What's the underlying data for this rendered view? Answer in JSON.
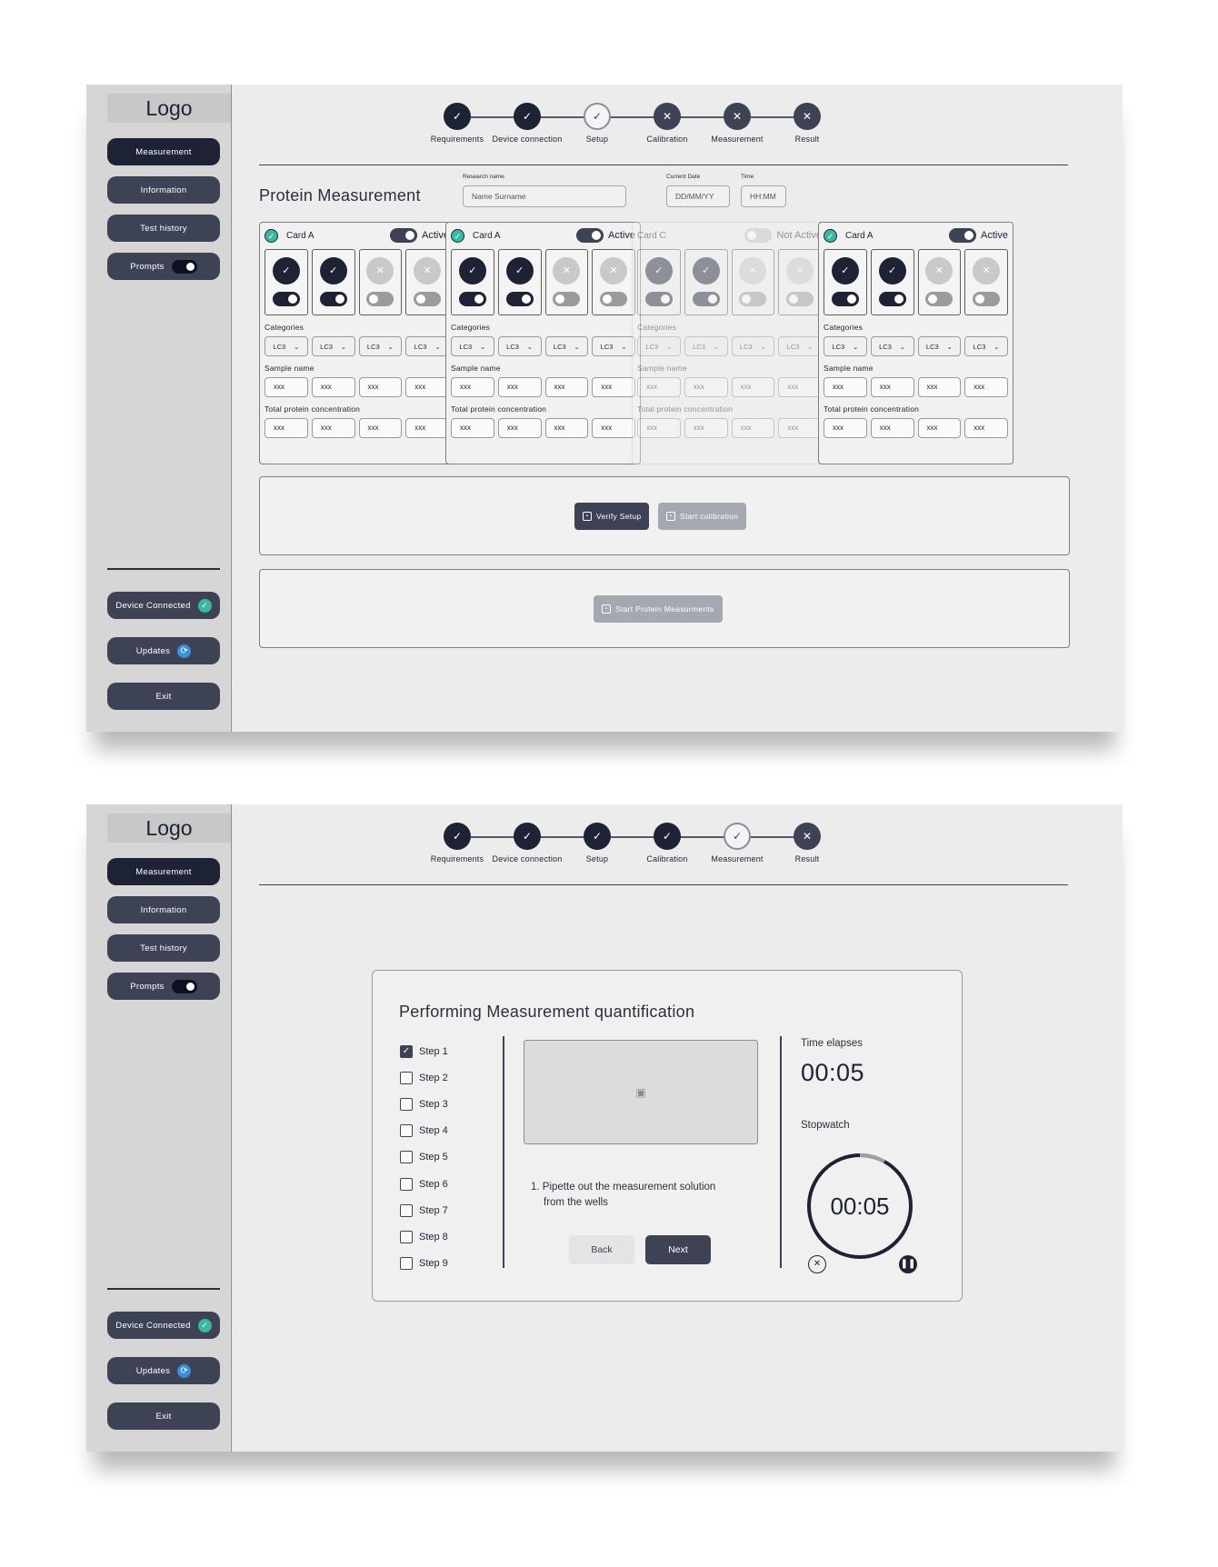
{
  "screen1": {
    "sidebar": {
      "logo": "Logo",
      "nav": [
        "Measurement",
        "Information",
        "Test history",
        "Prompts"
      ],
      "bottom": [
        "Device Connected",
        "Updates",
        "Exit"
      ]
    },
    "stepper": [
      {
        "label": "Requirements",
        "state": "done"
      },
      {
        "label": "Device connection",
        "state": "done"
      },
      {
        "label": "Setup",
        "state": "current"
      },
      {
        "label": "Calibration",
        "state": "pending"
      },
      {
        "label": "Measurement",
        "state": "pending"
      },
      {
        "label": "Result",
        "state": "pending"
      }
    ],
    "page_title": "Protein Measurement",
    "research_name": {
      "label": "Research name",
      "placeholder": "Name Surname"
    },
    "current_date": {
      "label": "Current Date",
      "placeholder": "DD/MM/YY"
    },
    "time": {
      "label": "Time",
      "placeholder": "HH:MM"
    },
    "cards": [
      {
        "name": "Card A",
        "status": "Active",
        "active": true,
        "wells": [
          true,
          true,
          false,
          false
        ]
      },
      {
        "name": "Card A",
        "status": "Active",
        "active": true,
        "wells": [
          true,
          true,
          false,
          false
        ]
      },
      {
        "name": "Card C",
        "status": "Not Active",
        "active": false,
        "wells": [
          true,
          true,
          false,
          false
        ]
      },
      {
        "name": "Card A",
        "status": "Active",
        "active": true,
        "wells": [
          true,
          true,
          false,
          false
        ]
      }
    ],
    "card_labels": {
      "categories": "Categories",
      "sample_name": "Sample name",
      "total_protein": "Total protein concentration",
      "category_option": "LC3",
      "field_value": "xxx"
    },
    "buttons": {
      "verify": "Verify Setup",
      "calibration": "Start calibration",
      "start_measure": "Start Protein Measurments"
    }
  },
  "screen2": {
    "sidebar": {
      "logo": "Logo",
      "nav": [
        "Measurement",
        "Information",
        "Test history",
        "Prompts"
      ],
      "bottom": [
        "Device Connected",
        "Updates",
        "Exit"
      ]
    },
    "stepper": [
      {
        "label": "Requirements",
        "state": "done"
      },
      {
        "label": "Device connection",
        "state": "done"
      },
      {
        "label": "Setup",
        "state": "done"
      },
      {
        "label": "Calibration",
        "state": "done"
      },
      {
        "label": "Measurement",
        "state": "current"
      },
      {
        "label": "Result",
        "state": "pending"
      }
    ],
    "panel_title": "Performing Measurement quantification",
    "steps": [
      {
        "label": "Step 1",
        "checked": true
      },
      {
        "label": "Step 2",
        "checked": false
      },
      {
        "label": "Step 3",
        "checked": false
      },
      {
        "label": "Step 4",
        "checked": false
      },
      {
        "label": "Step 5",
        "checked": false
      },
      {
        "label": "Step 6",
        "checked": false
      },
      {
        "label": "Step 7",
        "checked": false
      },
      {
        "label": "Step 8",
        "checked": false
      },
      {
        "label": "Step 9",
        "checked": false
      }
    ],
    "instruction_line1": "1. Pipette out the measurement solution",
    "instruction_line2": "from the wells",
    "back_label": "Back",
    "next_label": "Next",
    "time_elapsed_label": "Time elapses",
    "time_elapsed_value": "00:05",
    "stopwatch_label": "Stopwatch",
    "stopwatch_value": "00:05",
    "stopwatch_progress": 0.08
  },
  "icons": {
    "check": "check-icon",
    "cross": "close-icon",
    "image": "image-placeholder-icon",
    "refresh": "refresh-icon",
    "chevron": "chevron-down-icon",
    "pause": "pause-icon"
  },
  "colors": {
    "navy": "#1e2235",
    "slate": "#3d4354",
    "teal": "#3bb8a0",
    "blue": "#3b8fd9"
  }
}
